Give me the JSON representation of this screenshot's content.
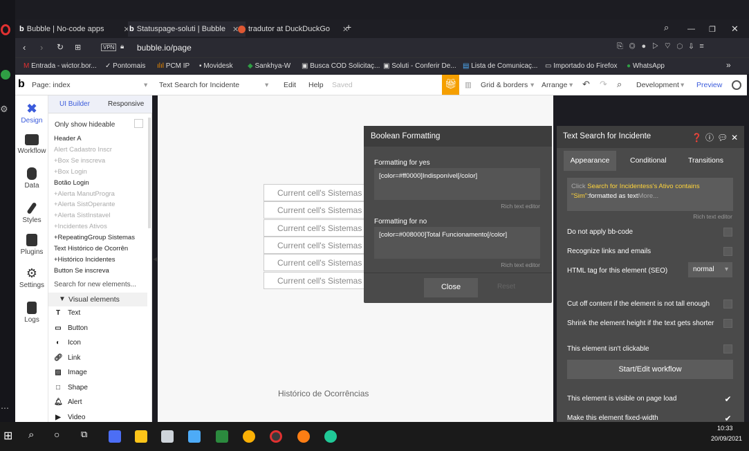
{
  "browser": {
    "tabs": [
      {
        "icon": "bubble-icon",
        "label": "Bubble | No-code apps",
        "close": "✕"
      },
      {
        "icon": "bubble-icon",
        "label": "Statuspage-soluti | Bubble",
        "close": "✕"
      },
      {
        "icon": "duckduckgo-icon",
        "label": "tradutor at DuckDuckGo",
        "close": "✕"
      }
    ],
    "new_tab": "+",
    "vpn": "VPN",
    "url": "bubble.io/page",
    "bookmarks": [
      {
        "label": "Entrada - wictor.bor..."
      },
      {
        "label": "Pontomais"
      },
      {
        "label": "PCM IP"
      },
      {
        "label": "Movidesk"
      },
      {
        "label": "Sankhya-W"
      },
      {
        "label": "Busca COD Solicitaç..."
      },
      {
        "label": "Soluti - Conferir De..."
      },
      {
        "label": "Lista de Comunicaç..."
      },
      {
        "label": "Importado do Firefox"
      },
      {
        "label": "WhatsApp"
      }
    ],
    "bookmarks_more": "»"
  },
  "editor_top": {
    "page_label": "Page: index",
    "element_select": "Text Search for Incidente",
    "edit": "Edit",
    "help": "Help",
    "saved": "Saved",
    "grid": "Grid & borders",
    "arrange": "Arrange",
    "dev": "Development",
    "preview": "Preview"
  },
  "left_nav": [
    {
      "label": "Design"
    },
    {
      "label": "Workflow"
    },
    {
      "label": "Data"
    },
    {
      "label": "Styles"
    },
    {
      "label": "Plugins"
    },
    {
      "label": "Settings"
    },
    {
      "label": "Logs"
    }
  ],
  "element_panel": {
    "tab_ui": "UI Builder",
    "tab_responsive": "Responsive",
    "only_show": "Only show hideable",
    "tree": [
      {
        "label": "Header A",
        "dim": false
      },
      {
        "label": "Alert Cadastro Inscr",
        "dim": true
      },
      {
        "label": "+Box Se inscreva",
        "dim": true
      },
      {
        "label": "+Box Login",
        "dim": true
      },
      {
        "label": "Botão Login",
        "dim": false
      },
      {
        "label": "+Alerta ManutProgra",
        "dim": true
      },
      {
        "label": "+Alerta SistOperante",
        "dim": true
      },
      {
        "label": "+Alerta SistInstavel",
        "dim": true
      },
      {
        "label": "+Incidentes Ativos",
        "dim": true
      },
      {
        "label": "+RepeatingGroup Sistemas",
        "dim": false
      },
      {
        "label": "Text Histórico de Ocorrên",
        "dim": false
      },
      {
        "label": "+Histórico Incidentes",
        "dim": false
      },
      {
        "label": "Button Se inscreva",
        "dim": false
      }
    ],
    "search_placeholder": "Search for new elements...",
    "visual_header": "Visual elements",
    "visual": [
      {
        "label": "Text"
      },
      {
        "label": "Button"
      },
      {
        "label": "Icon"
      },
      {
        "label": "Link"
      },
      {
        "label": "Image"
      },
      {
        "label": "Shape"
      },
      {
        "label": "Alert"
      },
      {
        "label": "Video"
      }
    ]
  },
  "canvas": {
    "cells": [
      "Current cell's Sistemas",
      "Current cell's Sistemas",
      "Current cell's Sistemas",
      "Current cell's Sistemas",
      "Current cell's Sistemas",
      "Current cell's Sistemas"
    ],
    "historico": "Histórico de Ocorrências"
  },
  "boolean_popup": {
    "title": "Boolean Formatting",
    "yes_label": "Formatting for yes",
    "yes_value": "[color=#ff0000]Indisponível[/color]",
    "no_label": "Formatting for no",
    "no_value": "[color=#008000]Total Funcionamento[/color]",
    "rich": "Rich text editor",
    "close": "Close",
    "reset": "Reset"
  },
  "property_editor": {
    "title": "Text Search for Incidente",
    "tabs": [
      "Appearance",
      "Conditional",
      "Transitions"
    ],
    "expr_click": "Click",
    "expr_yellow": "Search for Incidentess's Ativo contains \"Sim\"",
    "expr_white": ":formatted as text",
    "expr_more": "More...",
    "rich": "Rich text editor",
    "rows": [
      {
        "label": "Do not apply bb-code",
        "checked": false
      },
      {
        "label": "Recognize links and emails",
        "checked": false
      }
    ],
    "html_tag_label": "HTML tag for this element (SEO)",
    "html_tag_value": "normal",
    "rows2": [
      {
        "label": "Cut off content if the element is not tall enough",
        "checked": false
      },
      {
        "label": "Shrink the element height if the text gets shorter",
        "checked": false
      },
      {
        "label": "This element isn't clickable",
        "checked": false
      }
    ],
    "workflow_button": "Start/Edit workflow",
    "rows3": [
      {
        "label": "This element is visible on page load",
        "checked": true
      },
      {
        "label": "Make this element fixed-width",
        "checked": true
      }
    ],
    "checkmark": "✔"
  },
  "taskbar": {
    "time": "10:33",
    "date": "20/09/2021"
  },
  "colors": {
    "accent": "#3b5bdb",
    "popup": "#4a4a4a",
    "yellow": "#ffd43b",
    "gift": "#f59f00"
  }
}
